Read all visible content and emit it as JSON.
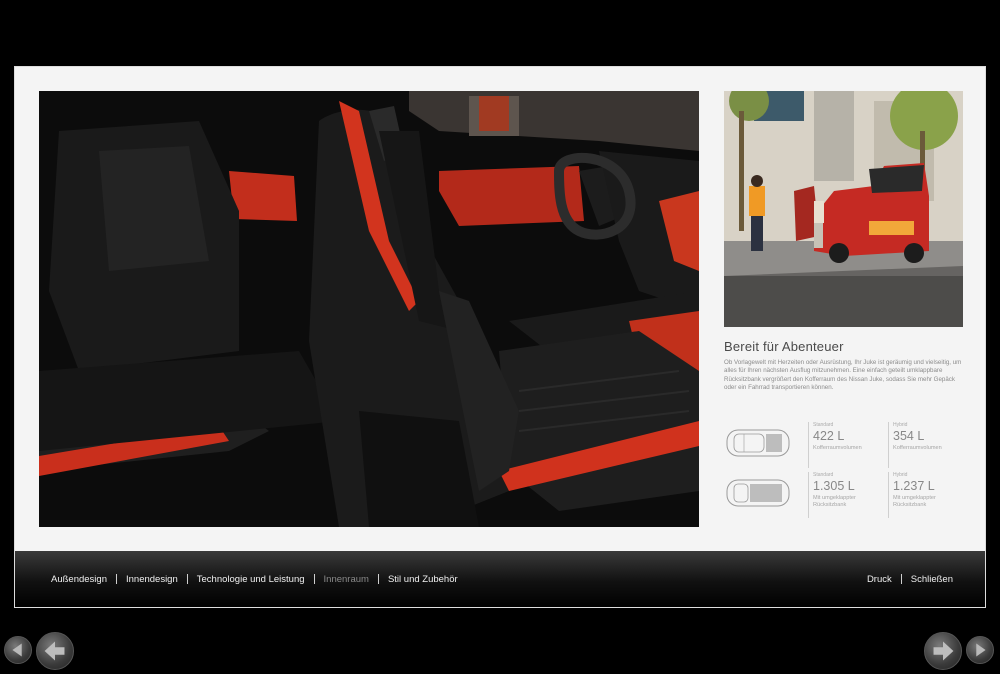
{
  "article": {
    "title": "Bereit für Abenteuer",
    "body": "Ob Vorlagewelt mit Herzeiten oder Ausrüstung, Ihr Juke ist geräumig und vielseitig, um alles für Ihren nächsten Ausflug mitzunehmen. Eine einfach geteilt umklappbare Rücksitzbank vergrößert den Kofferraum des Nissan Juke, sodass Sie mehr Gepäck oder ein Fahrrad transportieren können."
  },
  "specs": [
    {
      "label": "Standard",
      "value": "422 L",
      "desc": "Kofferraumvolumen"
    },
    {
      "label": "Hybrid",
      "value": "354 L",
      "desc": "Kofferraumvolumen"
    },
    {
      "label": "Standard",
      "value": "1.305 L",
      "desc": "Mit umgeklappter Rücksitzbank"
    },
    {
      "label": "Hybrid",
      "value": "1.237 L",
      "desc": "Mit umgeklappter Rücksitzbank"
    }
  ],
  "nav": {
    "left": [
      "Außendesign",
      "Innendesign",
      "Technologie und Leistung",
      "Innenraum",
      "Stil und Zubehör"
    ],
    "active_index": 3,
    "right": [
      "Druck",
      "Schließen"
    ]
  },
  "colors": {
    "accent_red": "#d8361f",
    "seat_black": "#141414",
    "page_bg": "#f4f4f4"
  },
  "icons": {
    "prev_page": "arrow-left-icon",
    "next_page": "arrow-right-icon",
    "first_page": "triangle-left-icon",
    "last_page": "triangle-right-icon"
  }
}
